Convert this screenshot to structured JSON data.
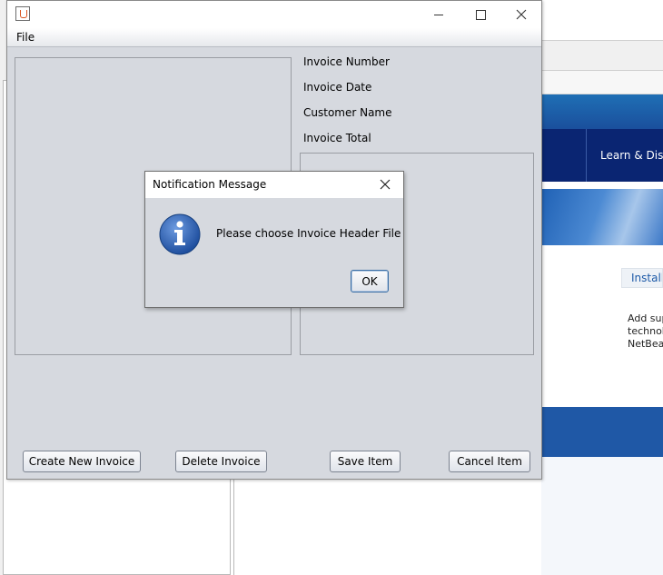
{
  "background_ide": {
    "learn_tab": "Learn & Disc",
    "install_button": "Install",
    "text_snippet": "Add sup\ntechnolo\nNetBear"
  },
  "window": {
    "title": "",
    "menu": {
      "file": "File"
    },
    "labels": {
      "invoice_number": "Invoice Number",
      "invoice_date": "Invoice Date",
      "customer_name": "Customer Name",
      "invoice_total": "Invoice Total"
    },
    "buttons": {
      "create_new_invoice": "Create New Invoice",
      "delete_invoice": "Delete Invoice",
      "save_item": "Save Item",
      "cancel_item": "Cancel Item"
    }
  },
  "dialog": {
    "title": "Notification Message",
    "message": "Please choose Invoice Header File",
    "ok_label": "OK",
    "icon": "information-icon"
  },
  "colors": {
    "window_bg": "#d6d9df",
    "netbeans_nav": "#0a2572",
    "netbeans_blue": "#1f58a6",
    "info_icon_blue": "#2f64b6"
  }
}
